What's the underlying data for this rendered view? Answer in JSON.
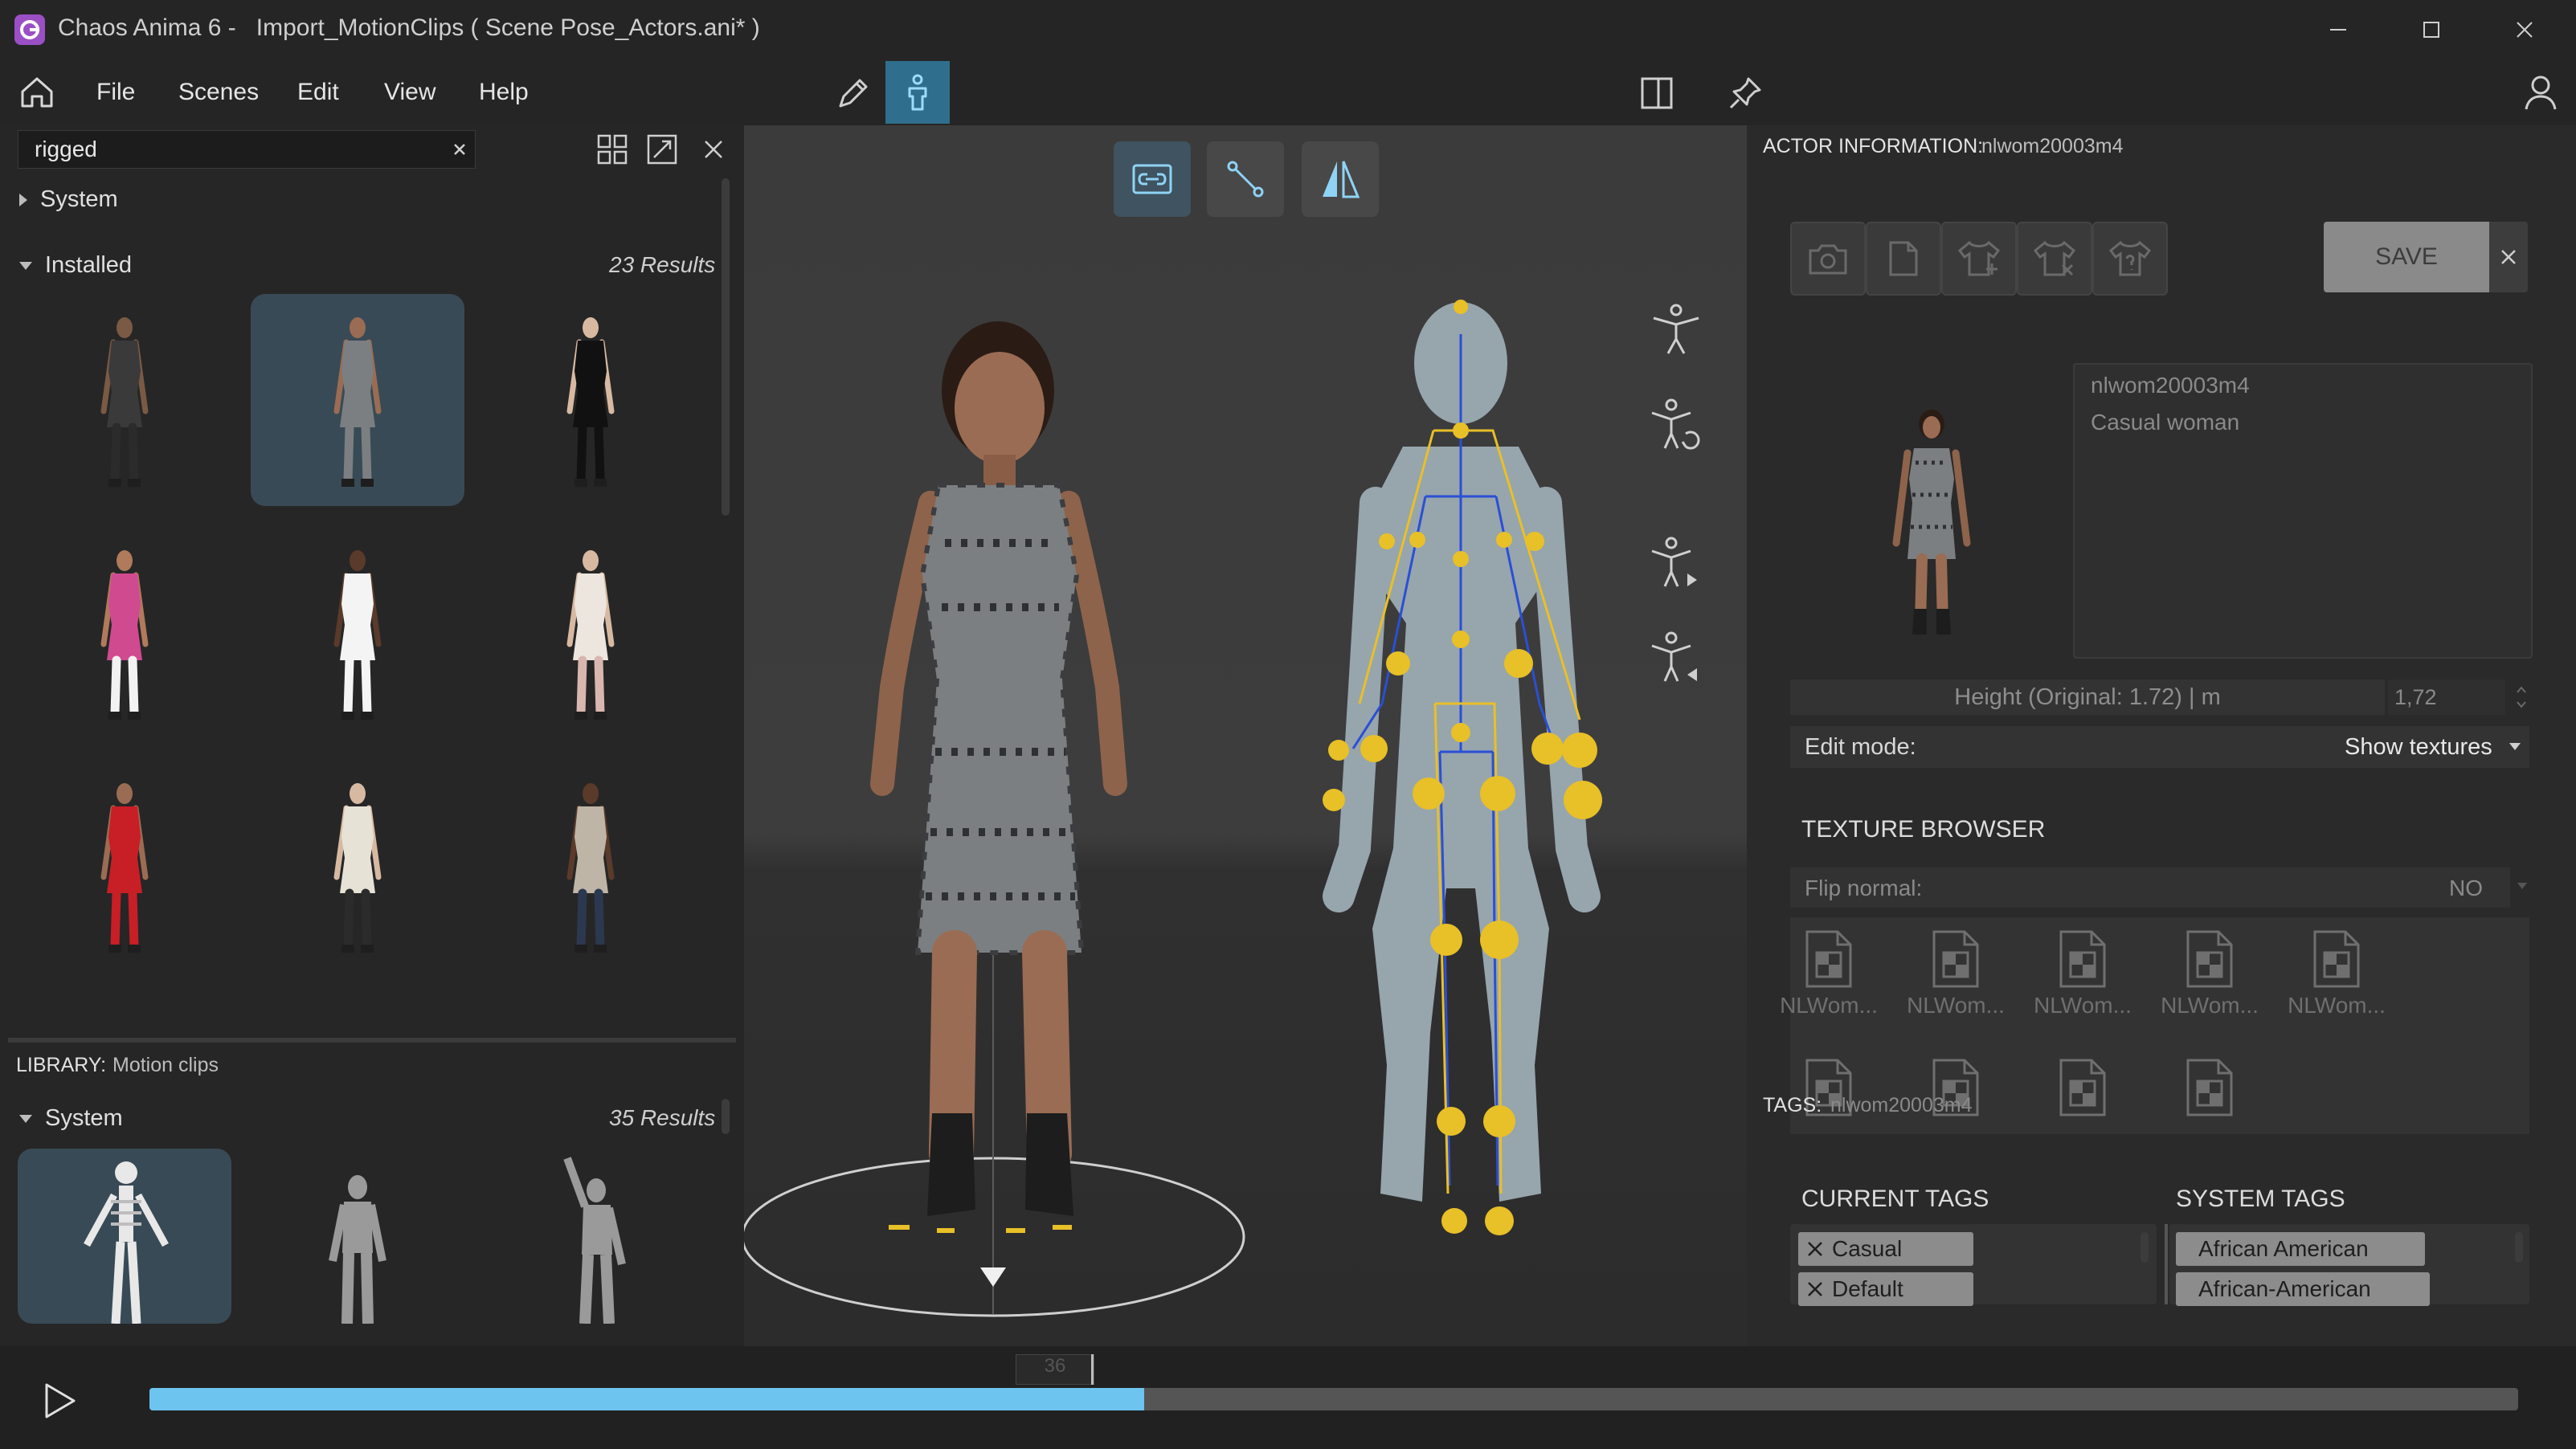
{
  "titlebar": {
    "app_name": "Chaos Anima 6 -",
    "document": "Import_MotionClips ( Scene Pose_Actors.ani* )"
  },
  "menu": {
    "items": [
      "File",
      "Scenes",
      "Edit",
      "View",
      "Help"
    ]
  },
  "library_panel": {
    "search": {
      "value": "rigged",
      "placeholder": ""
    },
    "tree": {
      "system_label": "System",
      "installed_label": "Installed",
      "installed_results": "23 Results"
    },
    "actors": [
      {
        "icon": "actor-casual-tank",
        "selected": false
      },
      {
        "icon": "actor-snakeskin-dress",
        "selected": true
      },
      {
        "icon": "actor-black-dress",
        "selected": false
      },
      {
        "icon": "actor-pink-top",
        "selected": false
      },
      {
        "icon": "actor-white-outfit",
        "selected": false
      },
      {
        "icon": "actor-white-blouse",
        "selected": false
      },
      {
        "icon": "actor-red-dress",
        "selected": false
      },
      {
        "icon": "actor-patterned-shirt",
        "selected": false
      },
      {
        "icon": "actor-suit-jacket",
        "selected": false
      }
    ]
  },
  "motion_library": {
    "label": "LIBRARY:",
    "value": "Motion clips",
    "system_label": "System",
    "results": "35 Results"
  },
  "actor_info": {
    "label": "ACTOR INFORMATION:",
    "id": "nlwom20003m4",
    "save_label": "SAVE",
    "description_lines": [
      "nlwom20003m4",
      "Casual woman"
    ],
    "height_label": "Height (Original: 1.72) | m",
    "height_value": "1,72",
    "edit_mode_label": "Edit mode:",
    "edit_mode_value": "Show textures",
    "texture_browser_title": "TEXTURE BROWSER",
    "flip_normal_label": "Flip normal:",
    "flip_normal_value": "NO",
    "textures": [
      "NLWom...",
      "NLWom...",
      "NLWom...",
      "NLWom...",
      "NLWom..."
    ],
    "tags_label": "TAGS:",
    "tags_value": "nlwom20003m4",
    "current_tags_title": "CURRENT TAGS",
    "system_tags_title": "SYSTEM TAGS",
    "current_tags": [
      "Casual",
      "Default"
    ],
    "system_tags": [
      "African American",
      "African-American"
    ]
  },
  "timeline": {
    "frame": "36",
    "progress": 0.42
  },
  "colors": {
    "accent": "#2f6f8d",
    "progress": "#6cc4ef",
    "joint": "#e8c027",
    "bone": "#2a4fd6",
    "app_icon": "#9b4fc4"
  }
}
